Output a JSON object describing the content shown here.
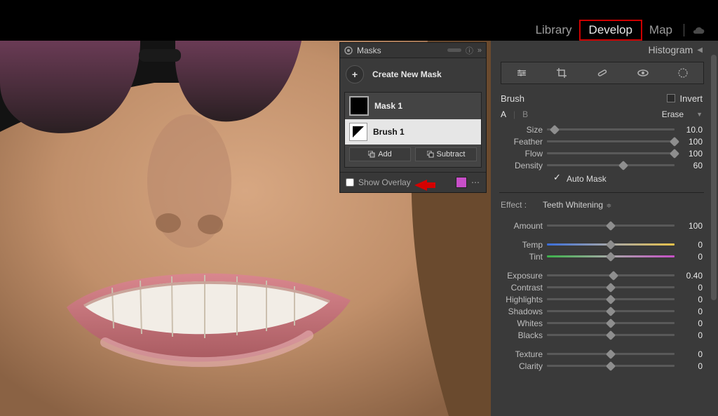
{
  "topnav": {
    "library": "Library",
    "develop": "Develop",
    "map": "Map"
  },
  "masks": {
    "title": "Masks",
    "create_label": "Create New Mask",
    "mask1": "Mask 1",
    "brush1": "Brush 1",
    "add_btn": "Add",
    "subtract_btn": "Subtract",
    "show_overlay": "Show Overlay",
    "overlay_color": "#c84fc8"
  },
  "right": {
    "histogram": "Histogram",
    "brush_label": "Brush",
    "invert_label": "Invert",
    "a_label": "A",
    "b_label": "B",
    "erase_label": "Erase",
    "automask_label": "Auto Mask",
    "effect_label": "Effect :",
    "effect_preset": "Teeth Whitening"
  },
  "sliders": {
    "size": {
      "label": "Size",
      "value": "10.0",
      "pct": 6
    },
    "feather": {
      "label": "Feather",
      "value": "100",
      "pct": 100
    },
    "flow": {
      "label": "Flow",
      "value": "100",
      "pct": 100
    },
    "density": {
      "label": "Density",
      "value": "60",
      "pct": 60
    },
    "amount": {
      "label": "Amount",
      "value": "100",
      "pct": 50
    },
    "temp": {
      "label": "Temp",
      "value": "0",
      "pct": 50
    },
    "tint": {
      "label": "Tint",
      "value": "0",
      "pct": 50
    },
    "exposure": {
      "label": "Exposure",
      "value": "0.40",
      "pct": 52
    },
    "contrast": {
      "label": "Contrast",
      "value": "0",
      "pct": 50
    },
    "highlights": {
      "label": "Highlights",
      "value": "0",
      "pct": 50
    },
    "shadows": {
      "label": "Shadows",
      "value": "0",
      "pct": 50
    },
    "whites": {
      "label": "Whites",
      "value": "0",
      "pct": 50
    },
    "blacks": {
      "label": "Blacks",
      "value": "0",
      "pct": 50
    },
    "texture": {
      "label": "Texture",
      "value": "0",
      "pct": 50
    },
    "clarity": {
      "label": "Clarity",
      "value": "0",
      "pct": 50
    }
  }
}
